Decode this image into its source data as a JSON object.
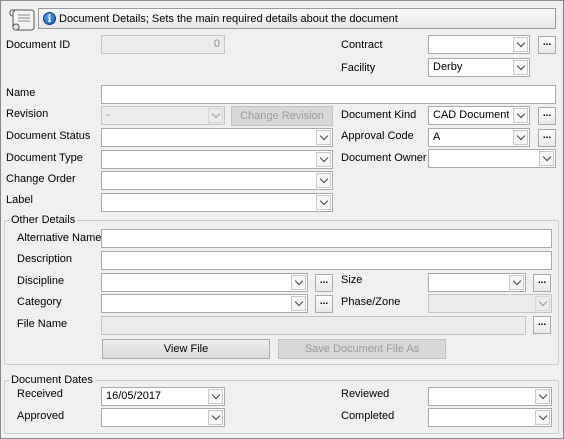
{
  "header": {
    "text": "Document Details; Sets the main required details about the document"
  },
  "fields": {
    "document_id": {
      "label": "Document ID",
      "value": "0"
    },
    "contract": {
      "label": "Contract",
      "value": ""
    },
    "facility": {
      "label": "Facility",
      "value": "Derby"
    },
    "name": {
      "label": "Name",
      "value": ""
    },
    "revision": {
      "label": "Revision",
      "value": "-"
    },
    "change_revision": {
      "label": "Change Revision"
    },
    "document_kind": {
      "label": "Document Kind",
      "value": "CAD Document"
    },
    "document_status": {
      "label": "Document Status",
      "value": ""
    },
    "approval_code": {
      "label": "Approval Code",
      "value": "A"
    },
    "document_type": {
      "label": "Document Type",
      "value": ""
    },
    "document_owner": {
      "label": "Document Owner",
      "value": ""
    },
    "change_order": {
      "label": "Change Order",
      "value": ""
    },
    "label": {
      "label": "Label",
      "value": ""
    }
  },
  "other_details": {
    "title": "Other Details",
    "alternative_name": {
      "label": "Alternative Name",
      "value": ""
    },
    "description": {
      "label": "Description",
      "value": ""
    },
    "discipline": {
      "label": "Discipline",
      "value": ""
    },
    "size": {
      "label": "Size",
      "value": ""
    },
    "category": {
      "label": "Category",
      "value": ""
    },
    "phase_zone": {
      "label": "Phase/Zone",
      "value": ""
    },
    "file_name": {
      "label": "File Name",
      "value": ""
    },
    "view_file": "View File",
    "save_file_as": "Save Document File As"
  },
  "document_dates": {
    "title": "Document Dates",
    "received": {
      "label": "Received",
      "value": "16/05/2017"
    },
    "reviewed": {
      "label": "Reviewed",
      "value": ""
    },
    "approved": {
      "label": "Approved",
      "value": ""
    },
    "completed": {
      "label": "Completed",
      "value": ""
    }
  },
  "ellipsis": "..."
}
